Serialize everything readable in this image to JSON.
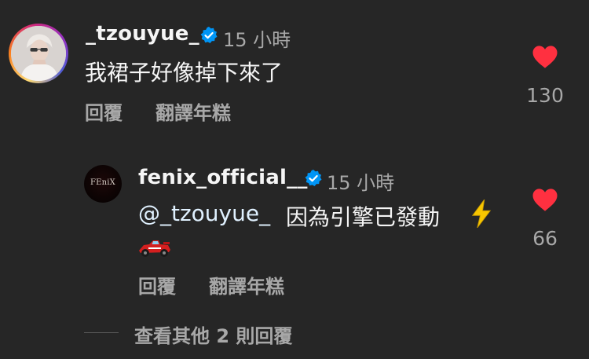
{
  "comment": {
    "username": "_tzouyue_",
    "timestamp": "15 小時",
    "text": "我裙子好像掉下來了",
    "reply_label": "回覆",
    "translate_label": "翻譯年糕",
    "like_count": "130",
    "liked": true
  },
  "reply": {
    "username": "fenix_official__",
    "avatar_text": "FEniX",
    "timestamp": "15 小時",
    "mention": "@_tzouyue_",
    "text": "因為引擎已發動",
    "emoji_1": "high-voltage-icon",
    "emoji_2": "racing-car-icon",
    "reply_label": "回覆",
    "translate_label": "翻譯年糕",
    "like_count": "66",
    "liked": true
  },
  "view_more": {
    "label": "查看其他 2 則回覆"
  },
  "colors": {
    "background": "#262626",
    "primary_text": "#f5f5f5",
    "secondary_text": "#a8a8a8",
    "heart": "#ff3040",
    "verified": "#0095f6",
    "mention": "#e0f1ff"
  }
}
